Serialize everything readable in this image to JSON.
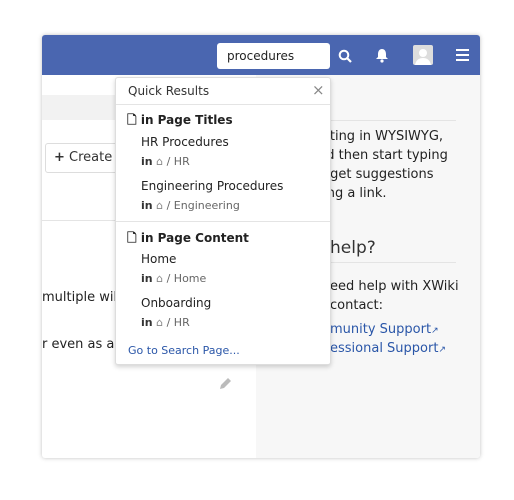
{
  "header": {
    "search_value": "procedures",
    "icons": [
      "search-icon",
      "bell-icon",
      "avatar",
      "hamburger-menu-icon"
    ]
  },
  "left": {
    "create_label": "Create",
    "text1": "multiple wiki",
    "text2": "r even as a c"
  },
  "right": {
    "lines": [
      "diting in WYSIWYG,",
      "nd then start typing",
      "o get suggestions",
      "ting a link."
    ],
    "heading": "help?",
    "help_lines": [
      "eed help with XWiki",
      "contact:"
    ],
    "links": [
      "munity Support",
      "essional Support"
    ]
  },
  "quick_results": {
    "title": "Quick Results",
    "close": "×",
    "sections": [
      {
        "label": "in Page Titles",
        "items": [
          {
            "title": "HR Procedures",
            "in": "in",
            "path": "/ HR"
          },
          {
            "title": "Engineering Procedures",
            "in": "in",
            "path": "/ Engineering"
          }
        ]
      },
      {
        "label": "in Page Content",
        "items": [
          {
            "title": "Home",
            "in": "in",
            "path": "/ Home"
          },
          {
            "title": "Onboarding",
            "in": "in",
            "path": "/ HR"
          }
        ]
      }
    ],
    "footer_link": "Go to Search Page..."
  },
  "colors": {
    "header": "#4a66b0",
    "link": "#2a56a8"
  }
}
